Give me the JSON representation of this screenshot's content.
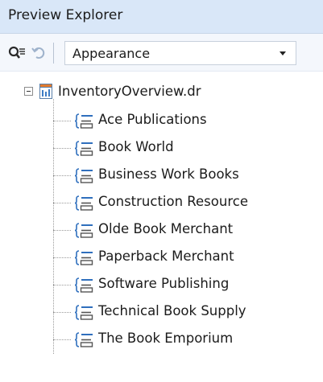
{
  "panel": {
    "title": "Preview Explorer"
  },
  "toolbar": {
    "buttons": [
      {
        "name": "search-next-icon",
        "label": "Find"
      },
      {
        "name": "refresh-icon",
        "label": "Refresh"
      }
    ],
    "view_select": {
      "value": "Appearance"
    }
  },
  "tree": {
    "root": {
      "label": "InventoryOverview.dr",
      "icon": "report-file-icon",
      "expanded": true
    },
    "children": [
      {
        "label": "Ace Publications"
      },
      {
        "label": "Book World"
      },
      {
        "label": "Business Work Books"
      },
      {
        "label": "Construction Resource"
      },
      {
        "label": "Olde Book Merchant"
      },
      {
        "label": "Paperback Merchant"
      },
      {
        "label": "Software Publishing"
      },
      {
        "label": "Technical Book Supply"
      },
      {
        "label": "The Book Emporium"
      }
    ]
  },
  "colors": {
    "title_bar_bg": "#d9e7f8",
    "toolbar_bg": "#f4f7fc",
    "accent_icon": "#2f6fbd"
  }
}
